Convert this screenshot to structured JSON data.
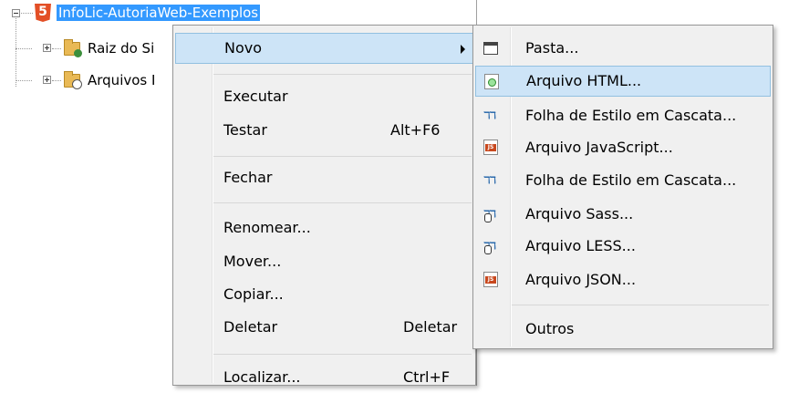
{
  "tree": {
    "project_label": "InfoLic-AutoriaWeb-Exemplos",
    "project_icon": "html5-icon",
    "children": [
      {
        "label": "Raiz do Si",
        "icon": "folder-globe-icon"
      },
      {
        "label": "Arquivos I",
        "icon": "folder-search-icon"
      }
    ]
  },
  "context_menu": {
    "items": [
      {
        "label": "Novo",
        "shortcut": "",
        "has_submenu": true,
        "highlighted": true
      },
      {
        "label": "Executar",
        "shortcut": ""
      },
      {
        "label": "Testar",
        "shortcut": "Alt+F6"
      },
      {
        "label": "Fechar",
        "shortcut": ""
      },
      {
        "label": "Renomear...",
        "shortcut": ""
      },
      {
        "label": "Mover...",
        "shortcut": ""
      },
      {
        "label": "Copiar...",
        "shortcut": ""
      },
      {
        "label": "Deletar",
        "shortcut": "Deletar"
      },
      {
        "label": "Localizar...",
        "shortcut": "Ctrl+F"
      }
    ]
  },
  "submenu": {
    "items": [
      {
        "label": "Pasta...",
        "icon": "folder-icon"
      },
      {
        "label": "Arquivo HTML...",
        "icon": "html-file-icon",
        "highlighted": true
      },
      {
        "label": "Folha de Estilo em Cascata...",
        "icon": "css-file-icon"
      },
      {
        "label": "Arquivo JavaScript...",
        "icon": "javascript-file-icon"
      },
      {
        "label": "Folha de Estilo em Cascata...",
        "icon": "css-file-icon"
      },
      {
        "label": "Arquivo Sass...",
        "icon": "sass-file-icon"
      },
      {
        "label": "Arquivo LESS...",
        "icon": "less-file-icon"
      },
      {
        "label": "Arquivo JSON...",
        "icon": "json-file-icon"
      },
      {
        "label": "Outros",
        "icon": ""
      }
    ]
  },
  "colors": {
    "selection": "#3399ff",
    "menu_background": "#f0f0f0",
    "menu_highlight": "#cde4f7",
    "html5_orange": "#e34f26"
  }
}
